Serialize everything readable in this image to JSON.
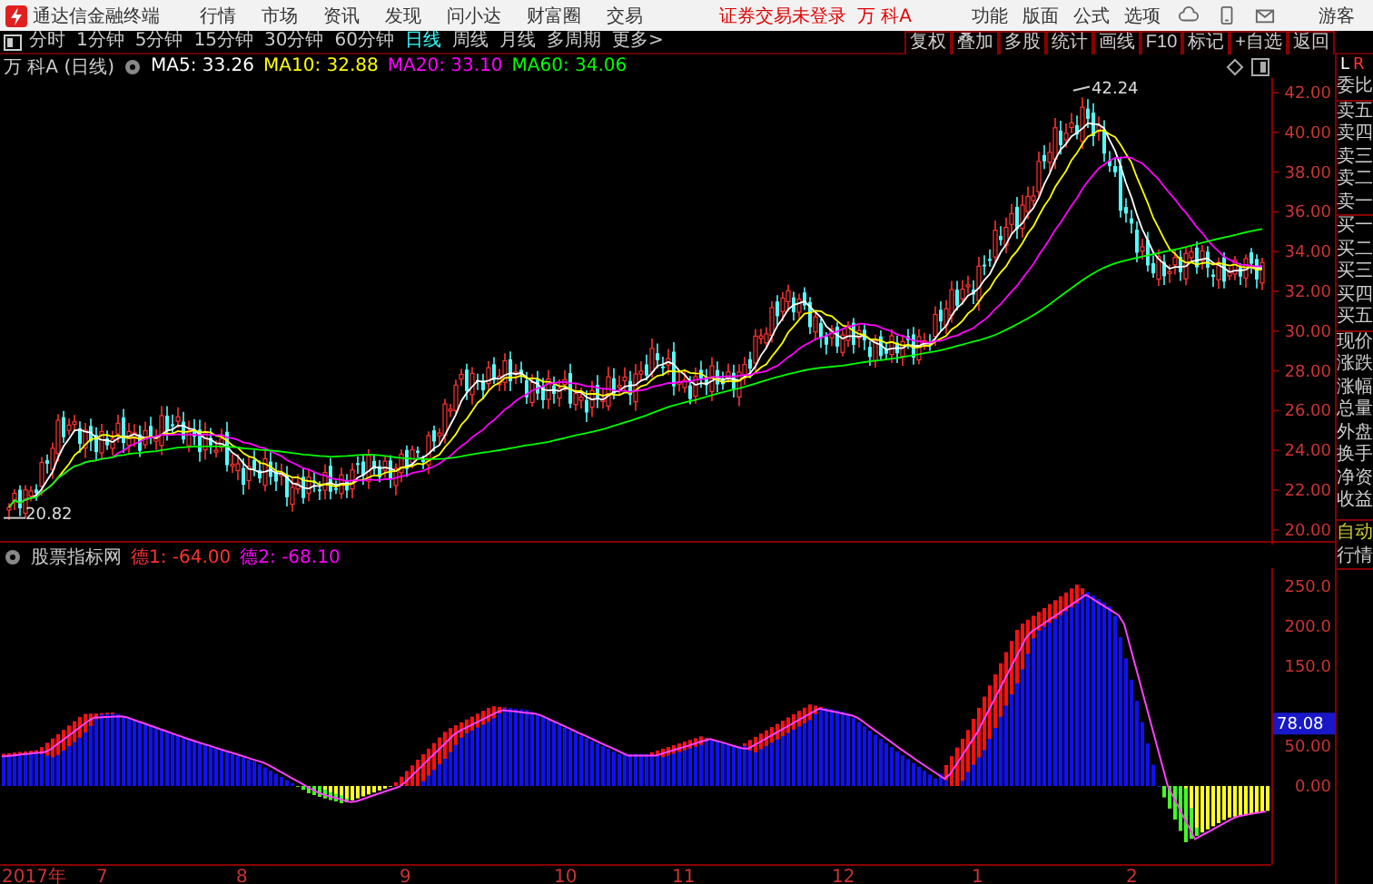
{
  "menu_bar": {
    "app_title": "通达信金融终端",
    "menu": [
      "行情",
      "市场",
      "资讯",
      "发现",
      "问小达",
      "财富圈",
      "交易"
    ],
    "login_status": "证券交易未登录",
    "stock": "万 科A",
    "tools": [
      "功能",
      "版面",
      "公式",
      "选项"
    ],
    "user": "游客"
  },
  "period_tabs": [
    {
      "label": "分时",
      "selected": false
    },
    {
      "label": "1分钟",
      "selected": false
    },
    {
      "label": "5分钟",
      "selected": false
    },
    {
      "label": "15分钟",
      "selected": false
    },
    {
      "label": "30分钟",
      "selected": false
    },
    {
      "label": "60分钟",
      "selected": false
    },
    {
      "label": "日线",
      "selected": true
    },
    {
      "label": "周线",
      "selected": false
    },
    {
      "label": "月线",
      "selected": false
    },
    {
      "label": "多周期",
      "selected": false
    },
    {
      "label": "更多>",
      "selected": false
    }
  ],
  "toolbar_buttons": [
    "复权",
    "叠加",
    "多股",
    "统计",
    "画线",
    "F10",
    "标记",
    "+自选",
    "返回"
  ],
  "chart_header": {
    "title": "万 科A (日线)",
    "ma": [
      {
        "label": "MA5: 33.26",
        "color": "#ffffff"
      },
      {
        "label": "MA10: 32.88",
        "color": "#ffff00"
      },
      {
        "label": "MA20: 33.10",
        "color": "#ff00ff"
      },
      {
        "label": "MA60: 34.06",
        "color": "#00ff00"
      }
    ]
  },
  "price_chart": {
    "high_label": "42.24",
    "low_label": "20.82",
    "y_axis": [
      "42.00",
      "40.00",
      "38.00",
      "36.00",
      "34.00",
      "32.00",
      "30.00",
      "28.00",
      "26.00",
      "24.00",
      "22.00",
      "20.00"
    ]
  },
  "indicator": {
    "title": "股票指标网",
    "values": [
      {
        "label": "德1: -64.00",
        "color": "#ff3030"
      },
      {
        "label": "德2: -68.10",
        "color": "#ff00ff"
      }
    ],
    "y_axis": [
      "250.0",
      "200.0",
      "150.0",
      "50.00",
      "0.00"
    ],
    "current_value": "78.08"
  },
  "date_axis": [
    "2017年",
    "7",
    "8",
    "9",
    "10",
    "11",
    "12",
    "1",
    "2"
  ],
  "quote_panel": {
    "header": [
      "L",
      "R"
    ],
    "labels": [
      "委比",
      "卖五",
      "卖四",
      "卖三",
      "卖二",
      "卖一",
      "买一",
      "买二",
      "买三",
      "买四",
      "买五",
      "现价",
      "涨跌",
      "涨幅",
      "总量",
      "外盘",
      "换手",
      "净资",
      "收益"
    ],
    "buttons": [
      "自动",
      "行情"
    ]
  }
}
